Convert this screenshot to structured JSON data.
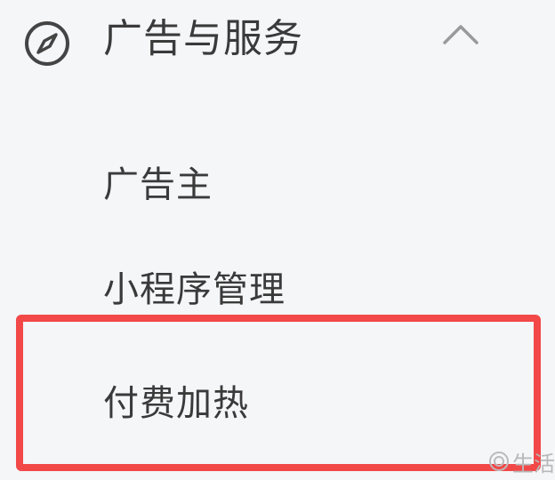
{
  "menu": {
    "group": {
      "title": "广告与服务",
      "icon": "compass-icon",
      "toggle_icon": "chevron-up-icon",
      "expanded": true
    },
    "items": [
      {
        "label": "广告主"
      },
      {
        "label": "小程序管理"
      },
      {
        "label": "付费加热",
        "highlighted": true
      }
    ]
  },
  "watermark": {
    "text": "生活",
    "icon": "watermark-logo-icon"
  },
  "colors": {
    "background": "#f5f6f8",
    "text": "#3a3a3a",
    "highlight": "#f24848",
    "icon": "#444444"
  }
}
